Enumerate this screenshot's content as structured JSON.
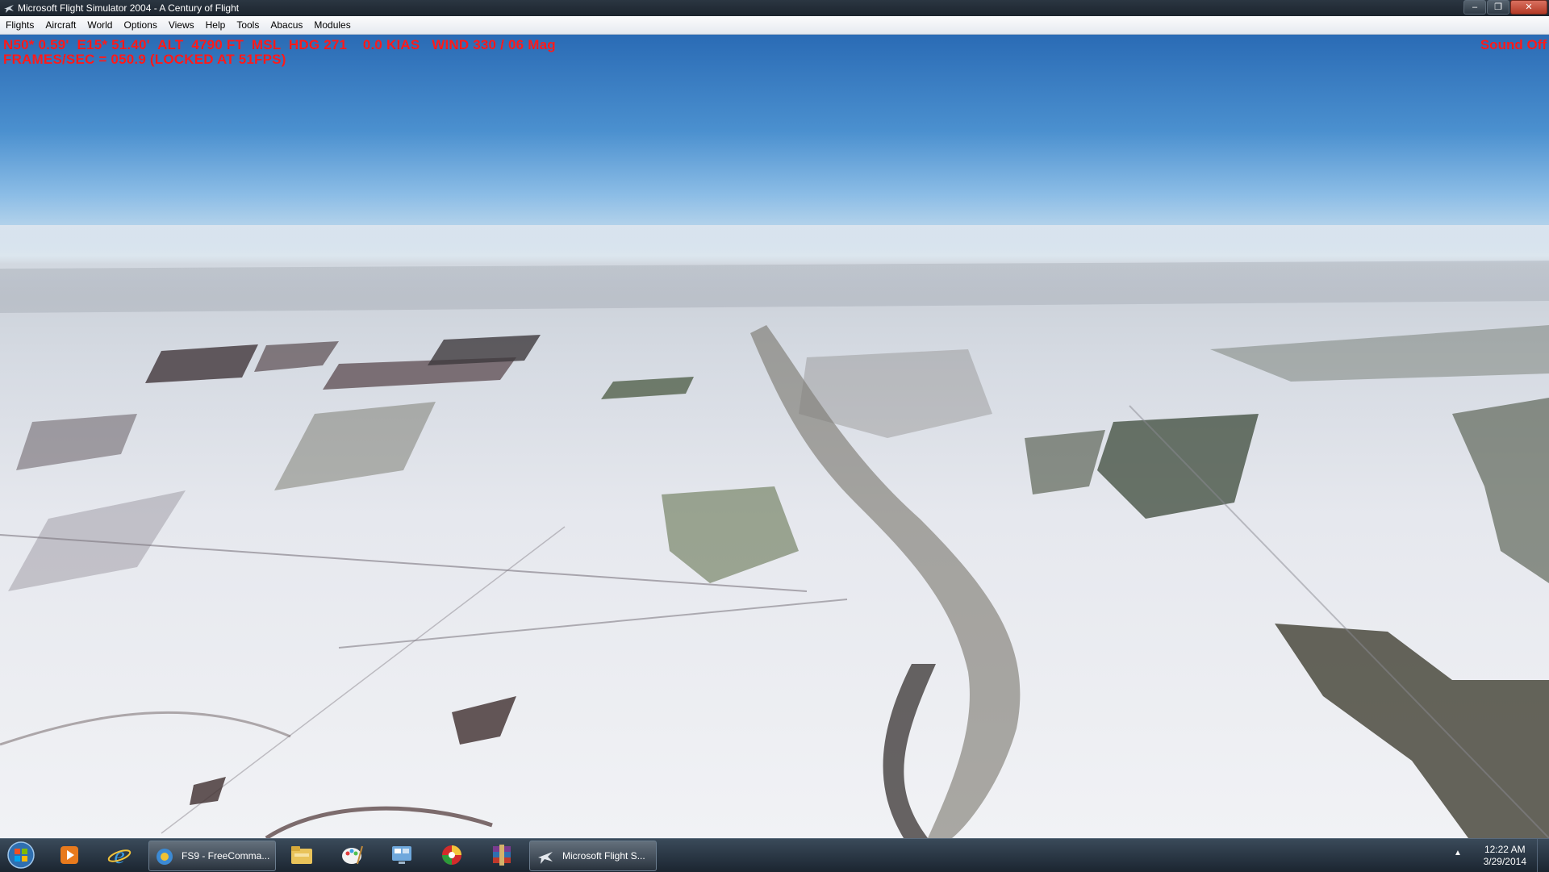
{
  "window": {
    "title": "Microsoft Flight Simulator 2004 - A Century of Flight",
    "minimize_glyph": "–",
    "restore_glyph": "❐",
    "close_glyph": "✕"
  },
  "menu": [
    "Flights",
    "Aircraft",
    "World",
    "Options",
    "Views",
    "Help",
    "Tools",
    "Abacus",
    "Modules"
  ],
  "hud": {
    "line1": "N50* 0.59'  E15* 51.40'  ALT  4790 FT  MSL  HDG 271    0.0 KIAS   WIND 330 / 06 Mag",
    "line2": "FRAMES/SEC = 050.9 (LOCKED AT 51FPS)",
    "sound": "Sound Off",
    "color": "#ff1a1a"
  },
  "taskbar": {
    "pinned": [
      "windows-media-player-icon",
      "internet-explorer-icon",
      "file-explorer-icon",
      "paint-icon",
      "control-panel-icon",
      "color-app-icon",
      "winrar-icon"
    ],
    "tasks": [
      {
        "label": "FS9 - FreeComma...",
        "icon": "fs9-icon"
      },
      {
        "label": "Microsoft Flight S...",
        "icon": "airplane-icon"
      }
    ],
    "clock_time": "12:22 AM",
    "clock_date": "3/29/2014",
    "tray_chevron": "▲"
  }
}
